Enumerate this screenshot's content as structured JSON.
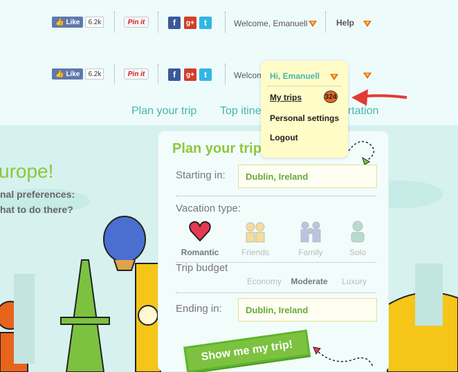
{
  "social": {
    "like_label": "Like",
    "like_count": "6.2k",
    "pin_label": "Pin it"
  },
  "user": {
    "welcome_text": "Welcome, Emanuell",
    "help_label": "Help"
  },
  "nav": {
    "items": [
      "Plan your trip",
      "Top itine",
      "ortation"
    ]
  },
  "hero": {
    "headline": "urope!",
    "line1": "nal preferences:",
    "line2": "hat to do there?"
  },
  "plan_card": {
    "title": "Plan your trip",
    "starting_label": "Starting in:",
    "starting_value": "Dublin, Ireland",
    "vacation_label": "Vacation type:",
    "vacation_types": [
      "Romantic",
      "Friends",
      "Family",
      "Solo"
    ],
    "selected_vacation": "Romantic",
    "budget_label": "Trip budget",
    "budget_options": [
      "Economy",
      "Moderate",
      "Luxury"
    ],
    "selected_budget": "Moderate",
    "ending_label": "Ending in:",
    "ending_value": "Dublin, Ireland",
    "submit_label": "Show me my trip!"
  },
  "dropdown": {
    "header": "Hi, Emanuell",
    "my_trips_label": "My trips",
    "my_trips_count": "324",
    "settings_label": "Personal settings",
    "logout_label": "Logout"
  },
  "colors": {
    "accent_green": "#8dc63f",
    "teal": "#45b5ad",
    "badge_orange": "#e8641c",
    "dropdown_bg": "#fffcc8",
    "arrow_red": "#e53935"
  }
}
